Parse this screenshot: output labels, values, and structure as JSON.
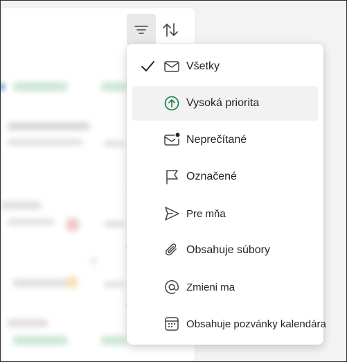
{
  "toolbar": {
    "filter_icon": "filter-lines-icon",
    "sort_icon": "sort-arrows-icon"
  },
  "filter_menu": {
    "selected_index": 0,
    "hover_index": 1,
    "accent_color": "#107c41",
    "items": [
      {
        "label": "Všetky",
        "icon": "mail-icon",
        "checked": true
      },
      {
        "label": "Vysoká priorita",
        "icon": "arrow-up-circle-icon",
        "checked": false
      },
      {
        "label": "Neprečítané",
        "icon": "mail-unread-icon",
        "checked": false
      },
      {
        "label": "Označené",
        "icon": "flag-icon",
        "checked": false
      },
      {
        "label": "Pre mňa",
        "icon": "send-icon",
        "checked": false
      },
      {
        "label": "Obsahuje súbory",
        "icon": "attach-icon",
        "checked": false
      },
      {
        "label": "Zmieni ma",
        "icon": "mention-icon",
        "checked": false
      },
      {
        "label": "Obsahuje pozvánky kalendára",
        "icon": "calendar-icon",
        "checked": false
      }
    ]
  }
}
